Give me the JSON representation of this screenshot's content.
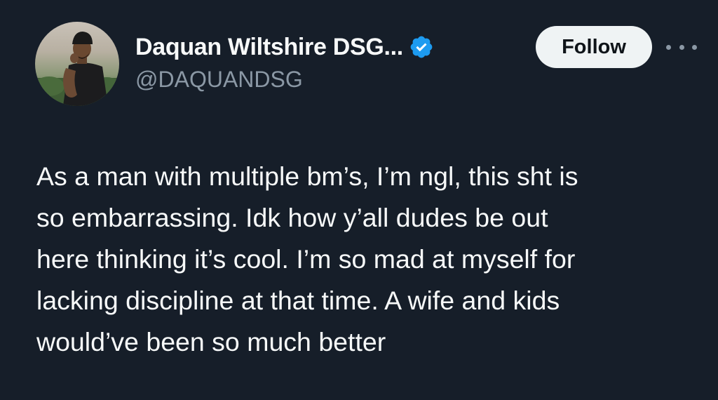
{
  "author": {
    "display_name": "Daquan Wiltshire DSG...",
    "handle": "@DAQUANDSG",
    "verified": true,
    "avatar_icon": "profile-photo"
  },
  "actions": {
    "follow_label": "Follow",
    "more_icon": "more-horizontal-icon"
  },
  "tweet": {
    "lines": [
      "As a man with multiple bm’s, I’m ngl, this sht is",
      "so embarrassing. Idk how y’all dudes be out",
      "here thinking it’s cool. I’m so mad at myself for",
      "lacking discipline at that time. A wife and kids",
      "would’ve been so much better"
    ]
  },
  "colors": {
    "background": "#161e29",
    "text_primary": "#f7f9f9",
    "text_secondary": "#8b98a5",
    "verified_blue": "#1d9bf0",
    "follow_bg": "#eff3f4"
  }
}
